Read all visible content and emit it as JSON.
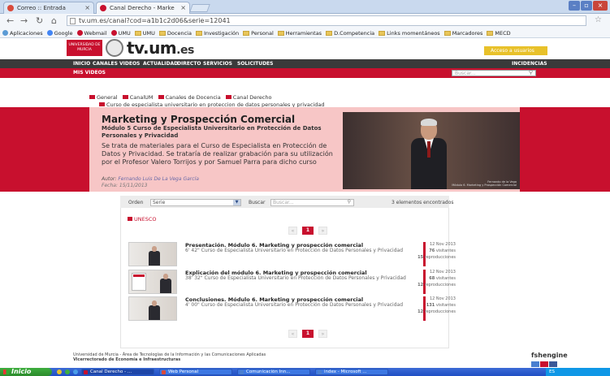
{
  "browser": {
    "tabs": [
      {
        "label": "Correo :: Entrada",
        "color": "#d94a3b"
      },
      {
        "label": "Canal Derecho - Marke",
        "color": "#c8102e"
      }
    ],
    "url": "tv.um.es/canal?cod=a1b1c2d06&serie=12041",
    "bookmarks": [
      {
        "label": "Aplicaciones",
        "kind": "apps"
      },
      {
        "label": "Google",
        "kind": "google"
      },
      {
        "label": "Webmail",
        "kind": "webmail"
      },
      {
        "label": "UMU",
        "kind": "umu"
      },
      {
        "label": "UMU",
        "kind": "folder"
      },
      {
        "label": "Docencia",
        "kind": "folder"
      },
      {
        "label": "Investigación",
        "kind": "folder"
      },
      {
        "label": "Personal",
        "kind": "folder"
      },
      {
        "label": "Herramientas",
        "kind": "folder"
      },
      {
        "label": "D.Competencia",
        "kind": "folder"
      },
      {
        "label": "Links momentáneos",
        "kind": "folder"
      },
      {
        "label": "Marcadores",
        "kind": "folder"
      },
      {
        "label": "MECD",
        "kind": "folder"
      }
    ]
  },
  "site": {
    "badge": "UNIVERSIDAD DE MURCIA",
    "logo": "tv.um",
    "logo_suffix": ".es",
    "access": "Acceso a usuarios",
    "nav": [
      "INICIO",
      "CANALES",
      "VIDEOS",
      "ACTUALIDAD",
      "DIRECTO",
      "SERVICIOS",
      "SOLICITUDES"
    ],
    "nav_right": "INCIDENCIAS",
    "subnav_title": "MIS VIDEOS",
    "search_placeholder": "Buscar..."
  },
  "breadcrumb": {
    "items": [
      "General",
      "CanalUM",
      "Canales de Docencia",
      "Canal Derecho"
    ],
    "current": "Curso de especialista universitario en proteccion de datos personales y privacidad"
  },
  "hero": {
    "title": "Marketing y Prospección Comercial",
    "subtitle": "Módulo 5 Curso de Especialista Universitario en Protección de Datos Personales y Privacidad",
    "description": "Se trata de materiales para el Curso de Especialista en Protección de Datos y Privacidad. Se trataría de realizar grabación para su utilización por el Profesor Valero Torrijos y por Samuel Parra para dicho curso",
    "author_label": "Autor:",
    "author": "Fernando Luis De La Vega García",
    "date_label": "Fecha:",
    "date": "15/11/2013",
    "video_caption_1": "Fernando de la Vega",
    "video_caption_2": "Módulo 6. Marketing y Prospección Comercial"
  },
  "listing": {
    "order_label": "Orden",
    "order_value": "Serie",
    "search_label": "Buscar",
    "search_placeholder": "Buscar...",
    "count": "3 elementos encontrados",
    "category": "UNESCO",
    "pager": {
      "prev": "«",
      "current": "1",
      "next": "»"
    },
    "items": [
      {
        "title": "Presentación. Módulo 6. Marketing y prospección comercial",
        "meta": "6' 42\" Curso de Especialista Universitario en Protección de Datos Personales y Privacidad",
        "date": "12 Nov 2013",
        "visitors": "76",
        "visitors_label": "visitantes",
        "plays": "15",
        "plays_label": "reproducciones",
        "thumb": "speaker"
      },
      {
        "title": "Explicación del módulo 6. Marketing y prospección comercial",
        "meta": "38' 32\" Curso de Especialista Universitario en Protección de Datos Personales y Privacidad",
        "date": "12 Nov 2013",
        "visitors": "68",
        "visitors_label": "visitantes",
        "plays": "12",
        "plays_label": "reproducciones",
        "thumb": "slides"
      },
      {
        "title": "Conclusiones. Módulo 6. Marketing y prospección comercial",
        "meta": "4' 00\" Curso de Especialista Universitario en Protección de Datos Personales y Privacidad",
        "date": "12 Nov 2013",
        "visitors": "131",
        "visitors_label": "visitantes",
        "plays": "12",
        "plays_label": "reproducciones",
        "thumb": "speaker"
      }
    ]
  },
  "footer": {
    "line1": "Universidad de Murcia - Área de Tecnologías de la Información y las Comunicaciones Aplicadas",
    "line2": "Vicerrectorado de Economía e Infraestructuras",
    "engine": "fshengine"
  },
  "taskbar": {
    "start": "Inicio",
    "tasks": [
      {
        "label": "Canal Derecho - ...",
        "color": "#c8102e"
      },
      {
        "label": "Web Personal",
        "color": "#d94a3b"
      },
      {
        "label": "Comunicación Inn...",
        "color": "#4a7fd0"
      },
      {
        "label": "index - Microsoft ...",
        "color": "#4a7fd0"
      }
    ],
    "tray": "ES"
  }
}
